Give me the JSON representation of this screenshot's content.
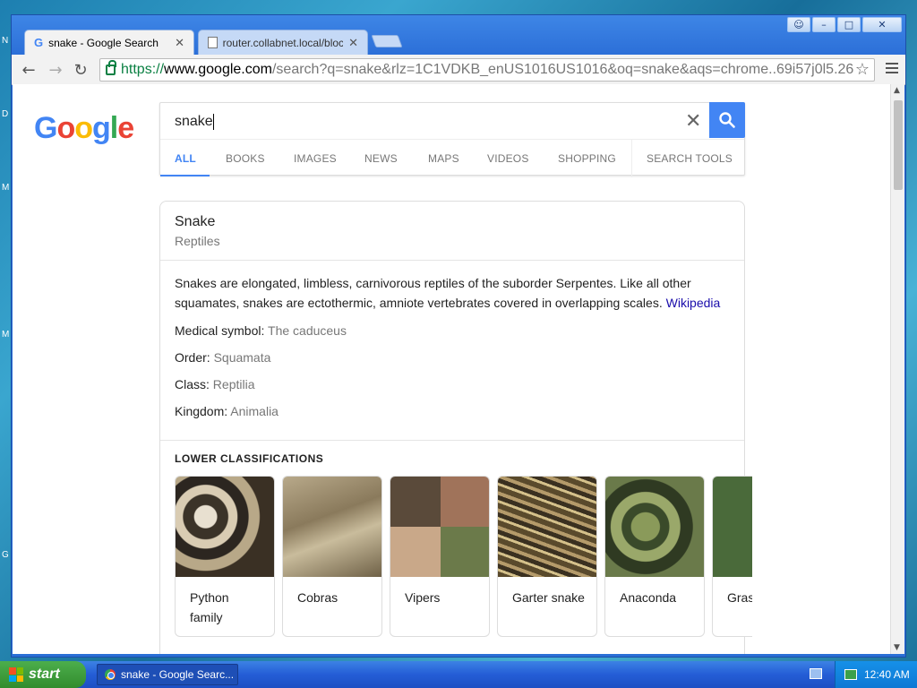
{
  "desktop": {
    "edge_letters": [
      "N",
      "D",
      "M",
      "M",
      "G"
    ]
  },
  "window": {
    "controls": [
      "☺",
      "–",
      "□",
      "✕"
    ]
  },
  "tabs": [
    {
      "title": "snake - Google Search",
      "active": true
    },
    {
      "title": "router.collabnet.local/blocke",
      "active": false
    }
  ],
  "toolbar": {
    "back": "←",
    "forward": "→",
    "reload": "↻",
    "url_scheme": "https://",
    "url_host": "www.google.com",
    "url_path": "/search?q=snake&rlz=1C1VDKB_enUS1016US1016&oq=snake&aqs=chrome..69i57j0l5.26",
    "star": "☆"
  },
  "google": {
    "logo_letters": [
      "G",
      "o",
      "o",
      "g",
      "l",
      "e"
    ],
    "query": "snake",
    "clear": "✕",
    "tabs": [
      "ALL",
      "BOOKS",
      "IMAGES",
      "NEWS",
      "MAPS",
      "VIDEOS",
      "SHOPPING",
      "SEARCH TOOLS"
    ]
  },
  "knowledge_panel": {
    "title": "Snake",
    "subtitle": "Reptiles",
    "description": "Snakes are elongated, limbless, carnivorous reptiles of the suborder Serpentes. Like all other squamates, snakes are ectothermic, amniote vertebrates covered in overlapping scales.",
    "source_link": "Wikipedia",
    "facts": [
      {
        "label": "Medical symbol:",
        "value": "The caduceus"
      },
      {
        "label": "Order:",
        "value": "Squamata"
      },
      {
        "label": "Class:",
        "value": "Reptilia"
      },
      {
        "label": "Kingdom:",
        "value": "Animalia"
      }
    ],
    "lower_classifications_heading": "LOWER CLASSIFICATIONS",
    "classifications": [
      {
        "name": "Python family"
      },
      {
        "name": "Cobras"
      },
      {
        "name": "Vipers"
      },
      {
        "name": "Garter snake"
      },
      {
        "name": "Anaconda"
      },
      {
        "name": "Grass snake"
      }
    ]
  },
  "taskbar": {
    "start_label": "start",
    "task_title": "snake - Google Searc...",
    "clock": "12:40 AM"
  },
  "colors": {
    "google_blue": "#4285f4",
    "link_blue": "#1a0dab",
    "xp_taskbar": "#245dd6",
    "start_green": "#328c2d"
  }
}
